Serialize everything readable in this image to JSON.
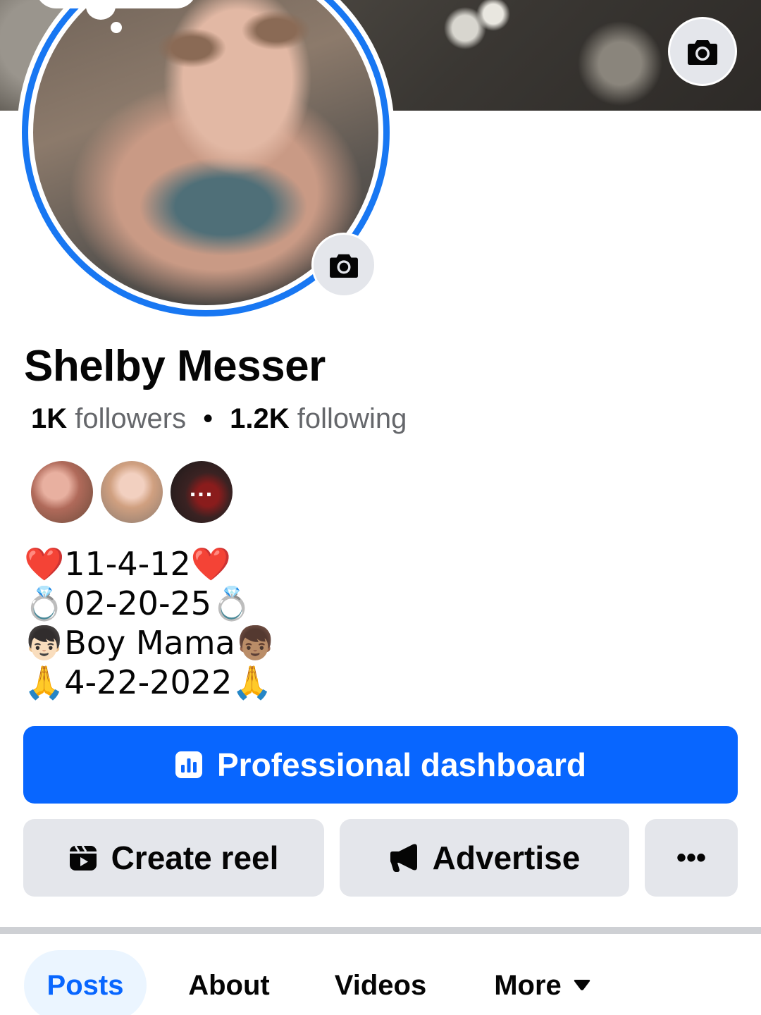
{
  "profile": {
    "name": "Shelby Messer",
    "followers_count": "1K",
    "followers_label": "followers",
    "following_count": "1.2K",
    "following_label": "following",
    "separator": "•"
  },
  "friends_preview": {
    "more_indicator": "..."
  },
  "bio": {
    "lines": [
      "❤️11-4-12❤️",
      "💍02-20-25💍",
      "👦🏻Boy Mama👦🏽",
      "🙏4-22-2022🙏"
    ]
  },
  "actions": {
    "primary_label": "Professional dashboard",
    "create_reel_label": "Create reel",
    "advertise_label": "Advertise",
    "more_label": "•••"
  },
  "tabs": [
    {
      "label": "Posts",
      "active": true
    },
    {
      "label": "About",
      "active": false
    },
    {
      "label": "Videos",
      "active": false
    },
    {
      "label": "More",
      "active": false
    }
  ],
  "colors": {
    "brand_blue": "#0866ff",
    "avatar_ring": "#1877f2",
    "button_grey": "#e4e6eb",
    "text_secondary": "#65676b"
  },
  "icons": [
    "camera-icon",
    "bar-chart-icon",
    "reel-icon",
    "megaphone-icon",
    "more-dots-icon",
    "caret-down-icon"
  ]
}
